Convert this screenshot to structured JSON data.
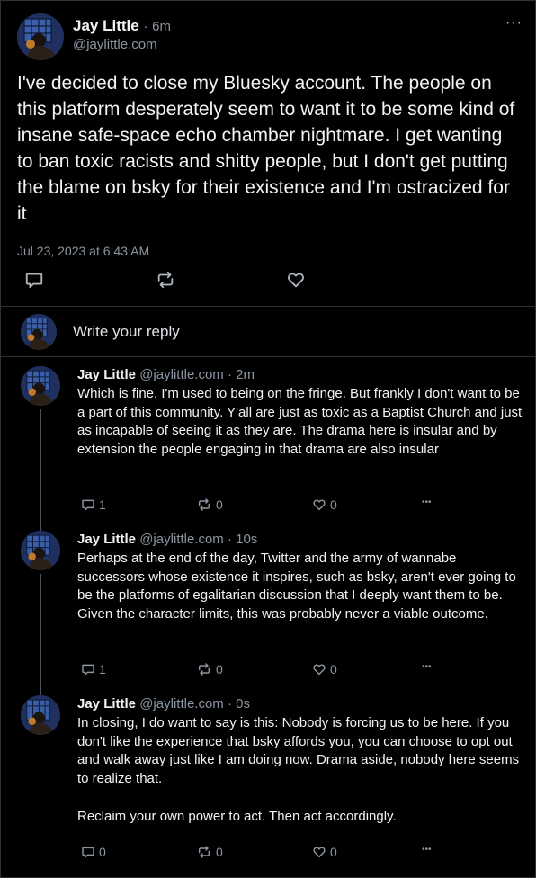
{
  "main_post": {
    "author_name": "Jay Little",
    "time_separator": "·",
    "time_ago": "6m",
    "handle": "@jaylittle.com",
    "text": "I've decided to close my Bluesky account. The people on this platform desperately seem to want it to be some kind of insane safe-space echo chamber nightmare. I get wanting to ban toxic racists and shitty people, but I don't get putting the blame on bsky for their existence and I'm ostracized for it",
    "date": "Jul 23, 2023 at 6:43 AM",
    "more_label": "···"
  },
  "reply_box": {
    "placeholder": "Write your reply"
  },
  "replies": [
    {
      "author_name": "Jay Little",
      "meta": "@jaylittle.com · 2m",
      "text": "Which is fine, I'm used to being on the fringe. But frankly I don't want to be a part of this community. Y'all are just as toxic as a Baptist Church and just as incapable of seeing it as they are. The drama here is insular and by extension the people engaging in that drama are also insular",
      "reply_count": "1",
      "repost_count": "0",
      "like_count": "0",
      "more_label": "•••"
    },
    {
      "author_name": "Jay Little",
      "meta": "@jaylittle.com · 10s",
      "text": "Perhaps at the end of the day, Twitter and the army of wannabe successors whose existence it inspires, such as bsky, aren't ever going to be the platforms of egalitarian discussion that I deeply want them to be. Given the character limits, this was probably never a viable outcome.",
      "reply_count": "1",
      "repost_count": "0",
      "like_count": "0",
      "more_label": "•••"
    },
    {
      "author_name": "Jay Little",
      "meta": "@jaylittle.com · 0s",
      "text": "In closing, I do want to say is this: Nobody is forcing us to be here. If you don't like the experience that bsky affords you, you can choose to opt out and walk away just like I am doing now. Drama aside, nobody here seems to realize that.\n\nReclaim your own power to act. Then act accordingly.",
      "reply_count": "0",
      "repost_count": "0",
      "like_count": "0",
      "more_label": "•••"
    }
  ],
  "icons": {
    "reply": "speech-bubble-icon",
    "repost": "repost-arrows-icon",
    "like": "heart-icon",
    "more": "ellipsis-icon"
  },
  "colors": {
    "background": "#000000",
    "text": "#f1f3f5",
    "muted": "#8c96a1",
    "divider": "#2e3235",
    "thread_line": "#4c535b"
  }
}
